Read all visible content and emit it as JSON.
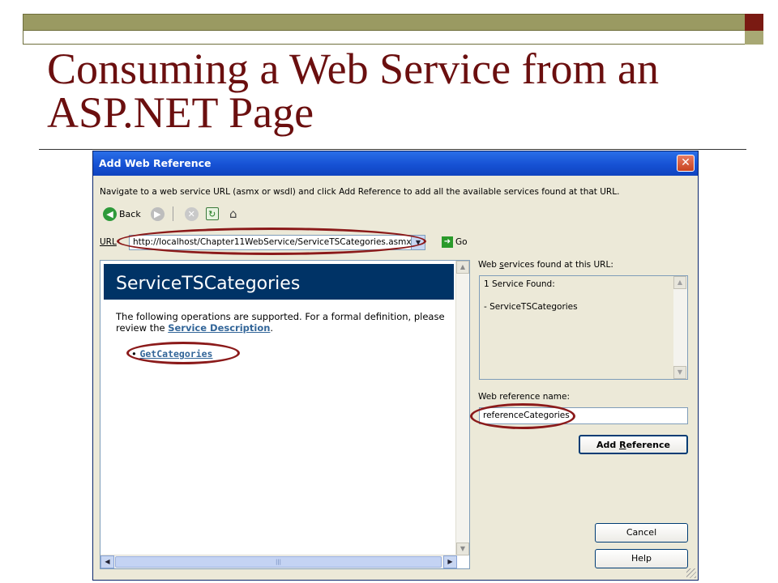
{
  "slide": {
    "title": "Consuming a Web Service from an ASP.NET Page"
  },
  "dialog": {
    "title": "Add Web Reference",
    "close_glyph": "✕",
    "instructions": "Navigate to a web service URL (asmx or wsdl) and click Add Reference to add all the available services found at that URL.",
    "toolbar": {
      "back_label": "Back"
    },
    "url": {
      "label": "URL",
      "value": "http://localhost/Chapter11WebService/ServiceTSCategories.asmx",
      "go_label": "Go"
    },
    "browser": {
      "service_name": "ServiceTSCategories",
      "desc_prefix": "The following operations are supported. For a formal definition, please review the ",
      "desc_link": "Service Description",
      "desc_suffix": ".",
      "operations": [
        "GetCategories"
      ]
    },
    "services_found": {
      "label_pre": "Web ",
      "label_accel": "s",
      "label_post": "ervices found at this URL:",
      "line1": "1 Service Found:",
      "line2": "- ServiceTSCategories"
    },
    "reference": {
      "label": "Web reference name:",
      "value": "referenceCategories"
    },
    "buttons": {
      "add_pre": "Add ",
      "add_accel": "R",
      "add_post": "eference",
      "cancel": "Cancel",
      "help": "Help"
    }
  },
  "colors": {
    "title_text": "#6b0f0f",
    "highlight_ring": "#8b1a1a",
    "xp_titlebar": "#1651d4",
    "service_header": "#003366"
  }
}
